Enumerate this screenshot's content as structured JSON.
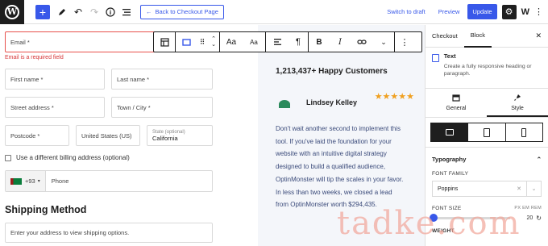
{
  "topbar": {
    "back_label": "Back to Checkout Page",
    "switch_draft": "Switch to draft",
    "preview": "Preview",
    "update": "Update"
  },
  "form": {
    "email_label": "Email *",
    "email_error": "Email is a required field",
    "first_name": "First name *",
    "last_name": "Last name *",
    "street": "Street address *",
    "town": "Town / City *",
    "postcode": "Postcode *",
    "country": "United States (US)",
    "state_label": "State (optional)",
    "state_value": "California",
    "different_billing": "Use a different billing address (optional)",
    "phone_code": "+93",
    "phone_placeholder": "Phone",
    "shipping_title": "Shipping Method",
    "shipping_hint": "Enter your address to view shipping options."
  },
  "block_toolbar": {
    "aa_large": "Aa",
    "aa_small": "Aa"
  },
  "testimonial": {
    "headline": "1,213,437+ Happy Customers",
    "name": "Lindsey Kelley",
    "rating": 5,
    "stars": "★★★★★",
    "text": "Don't wait another second to implement this tool. If you've laid the foundation for your website with an intuitive digital strategy designed to build a qualified audience, OptinMonster will tip the scales in your favor. In less than two weeks, we closed a lead from OptinMonster worth $294,435."
  },
  "sidebar": {
    "tab_checkout": "Checkout",
    "tab_block": "Block",
    "block_title": "Text",
    "block_desc": "Create a fully responsive heading or paragraph.",
    "tab_general": "General",
    "tab_style": "Style",
    "typography": "Typography",
    "font_family_label": "FONT FAMILY",
    "font_family_value": "Poppins",
    "font_size_label": "FONT SIZE",
    "font_size_value": "20",
    "units": "PX EM REM",
    "weight_label": "WEIGHT"
  },
  "watermark": "tadke.com"
}
